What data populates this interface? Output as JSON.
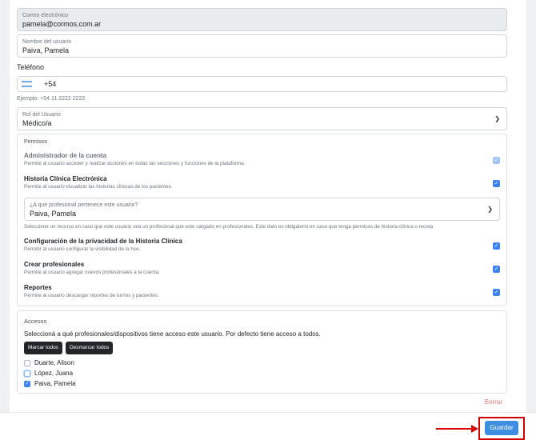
{
  "email": {
    "label": "Correo electrónico",
    "value": "pamela@cormos.com.ar"
  },
  "username": {
    "label": "Nombre del usuario",
    "value": "Paiva, Pamela"
  },
  "phone": {
    "label": "Teléfono",
    "code": "+54",
    "hint": "Ejemplo: +54 11 2222 2222",
    "flag": "argentina-flag-icon"
  },
  "role": {
    "label": "Rol del Usuario",
    "value": "Médico/a"
  },
  "permissions": {
    "title": "Permisos",
    "items": [
      {
        "title": "Administrador de la cuenta",
        "desc": "Permite al usuario acceder y realizar acciones en todas las secciones y funciones de la plataforma.",
        "checked": true,
        "disabled": true
      },
      {
        "title": "Historia Clínica Electrónica",
        "desc": "Permite al usuario visualizar las historias clínicas de los pacientes",
        "checked": true,
        "disabled": false
      }
    ],
    "professional_select": {
      "label": "¿A qué profesional pertenece este usuario?",
      "value": "Paiva, Pamela"
    },
    "professional_note": "Seleccione un recurso en caso que este usuario sea un profesional que este cargado en profesionales. Este dato es obligatorio en caso que tenga permisos de historia clínica o receta",
    "more_items": [
      {
        "title": "Configuración de la privacidad de la Historia Clínica",
        "desc": "Permitir al usuario configurar la visibilidad de la hce.",
        "checked": true
      },
      {
        "title": "Crear profesionales",
        "desc": "Permite al usuario agregar nuevos profesionales a la cuenta.",
        "checked": true
      },
      {
        "title": "Reportes",
        "desc": "Permite al usuario descargar reportes de turnos y pacientes.",
        "checked": true
      }
    ]
  },
  "access": {
    "title": "Accesos",
    "desc": "Seleccioná a qué profesionales/dispositivos tiene acceso este usuario. Por defecto tiene acceso a todos.",
    "mark_all": "Marcar todos",
    "unmark_all": "Desmarcar todos",
    "users": [
      {
        "name": "Duarte, Alison",
        "checked": false
      },
      {
        "name": "López, Juana",
        "checked": false
      },
      {
        "name": "Paiva, Pamela",
        "checked": true
      }
    ]
  },
  "delete_label": "Borrar",
  "save_label": "Guardar",
  "colors": {
    "primary": "#3d8ee0",
    "highlight": "#d40000",
    "delete": "#e07a7a"
  }
}
